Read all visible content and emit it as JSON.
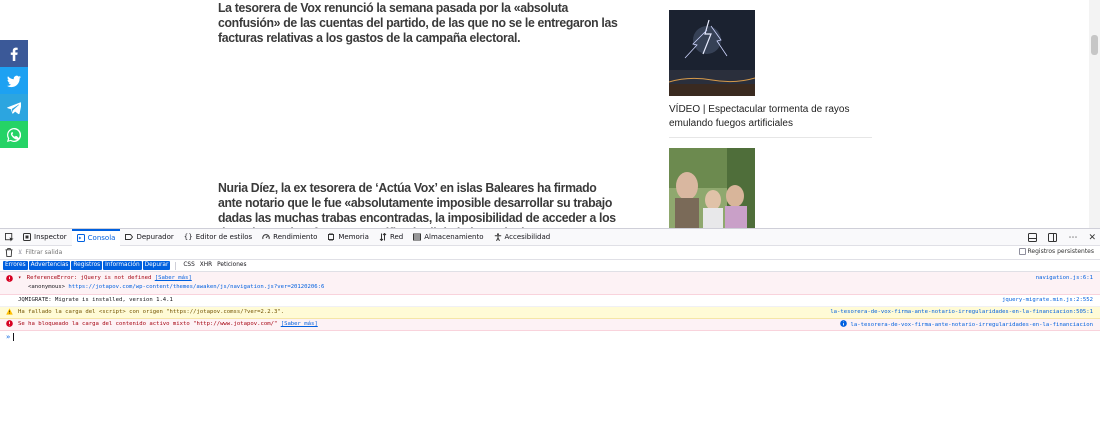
{
  "article": {
    "paragraph1": "La tesorera de Vox renunció la semana pasada por la «absoluta confusión» de las cuentas del partido, de las que  no se le entregaron las facturas relativas a los gastos de la campaña electoral.",
    "paragraph2": "Nuria Díez, la ex tesorera de ‘Actúa Vox’ en islas Baleares ha firmado ante notario que le fue «absolutamente imposible desarrollar su trabajo dadas las muchas trabas encontradas, la imposibilidad de acceder a los datos bancarios, facturas, certificado digital, datos de donantes, etcétera»."
  },
  "share_bar": {
    "icons": [
      "facebook-icon",
      "twitter-icon",
      "telegram-icon",
      "whatsapp-icon"
    ]
  },
  "sidebar": {
    "cards": [
      {
        "caption": "VÍDEO | Espectacular tormenta de rayos emulando fuegos artificiales",
        "thumb": "lightning-storm-photo"
      },
      {
        "caption": "",
        "thumb": "family-outdoor-photo"
      }
    ]
  },
  "devtools": {
    "tabs": [
      {
        "label": "Inspector",
        "icon": "inspector-icon"
      },
      {
        "label": "Consola",
        "icon": "console-icon",
        "active": true
      },
      {
        "label": "Depurador",
        "icon": "debugger-icon"
      },
      {
        "label": "Editor de estilos",
        "icon": "style-editor-icon"
      },
      {
        "label": "Rendimiento",
        "icon": "performance-icon"
      },
      {
        "label": "Memoria",
        "icon": "memory-icon"
      },
      {
        "label": "Red",
        "icon": "network-icon"
      },
      {
        "label": "Almacenamiento",
        "icon": "storage-icon"
      },
      {
        "label": "Accesibilidad",
        "icon": "accessibility-icon"
      }
    ],
    "filter_placeholder": "Filtrar salida",
    "persist_label": "Registros persistentes",
    "filter_chips": [
      "Errores",
      "Advertencias",
      "Registros",
      "Información",
      "Depurar"
    ],
    "extra_chips": [
      "CSS",
      "XHR",
      "Peticiones"
    ],
    "messages": {
      "m1_text": "ReferenceError: jQuery is not defined",
      "m1_link": "[Saber más]",
      "m1_src": "navigation.js:6:1",
      "m1_sub_label": "<anonymous>",
      "m1_sub_url": "https://jotapov.com/wp-content/themes/awaken/js/navigation.js?ver=20120206:6",
      "m2_text": "JQMIGRATE: Migrate is installed, version 1.4.1",
      "m2_src": "jquery-migrate.min.js:2:552",
      "m3_text": "Ha fallado la carga del <script> con origen \"https://jotapov.comss/?ver=2.2.3\".",
      "m3_src": "la-tesorera-de-vox-firma-ante-notario-irregularidades-en-la-financiacion:505:1",
      "m4_text": "Se ha bloqueado la carga del contenido activo mixto \"http://www.jotapov.com/\"",
      "m4_link": "[Saber más]",
      "m4_src": "la-tesorera-de-vox-firma-ante-notario-irregularidades-en-la-financiacion"
    },
    "prompt": "»"
  },
  "colors": {
    "accent": "#0060df",
    "error_bg": "#fdf2f5",
    "warning_bg": "#fffbd6",
    "facebook": "#3b5998",
    "twitter": "#1da1f2",
    "telegram": "#2ca5e0",
    "whatsapp": "#25d366"
  }
}
